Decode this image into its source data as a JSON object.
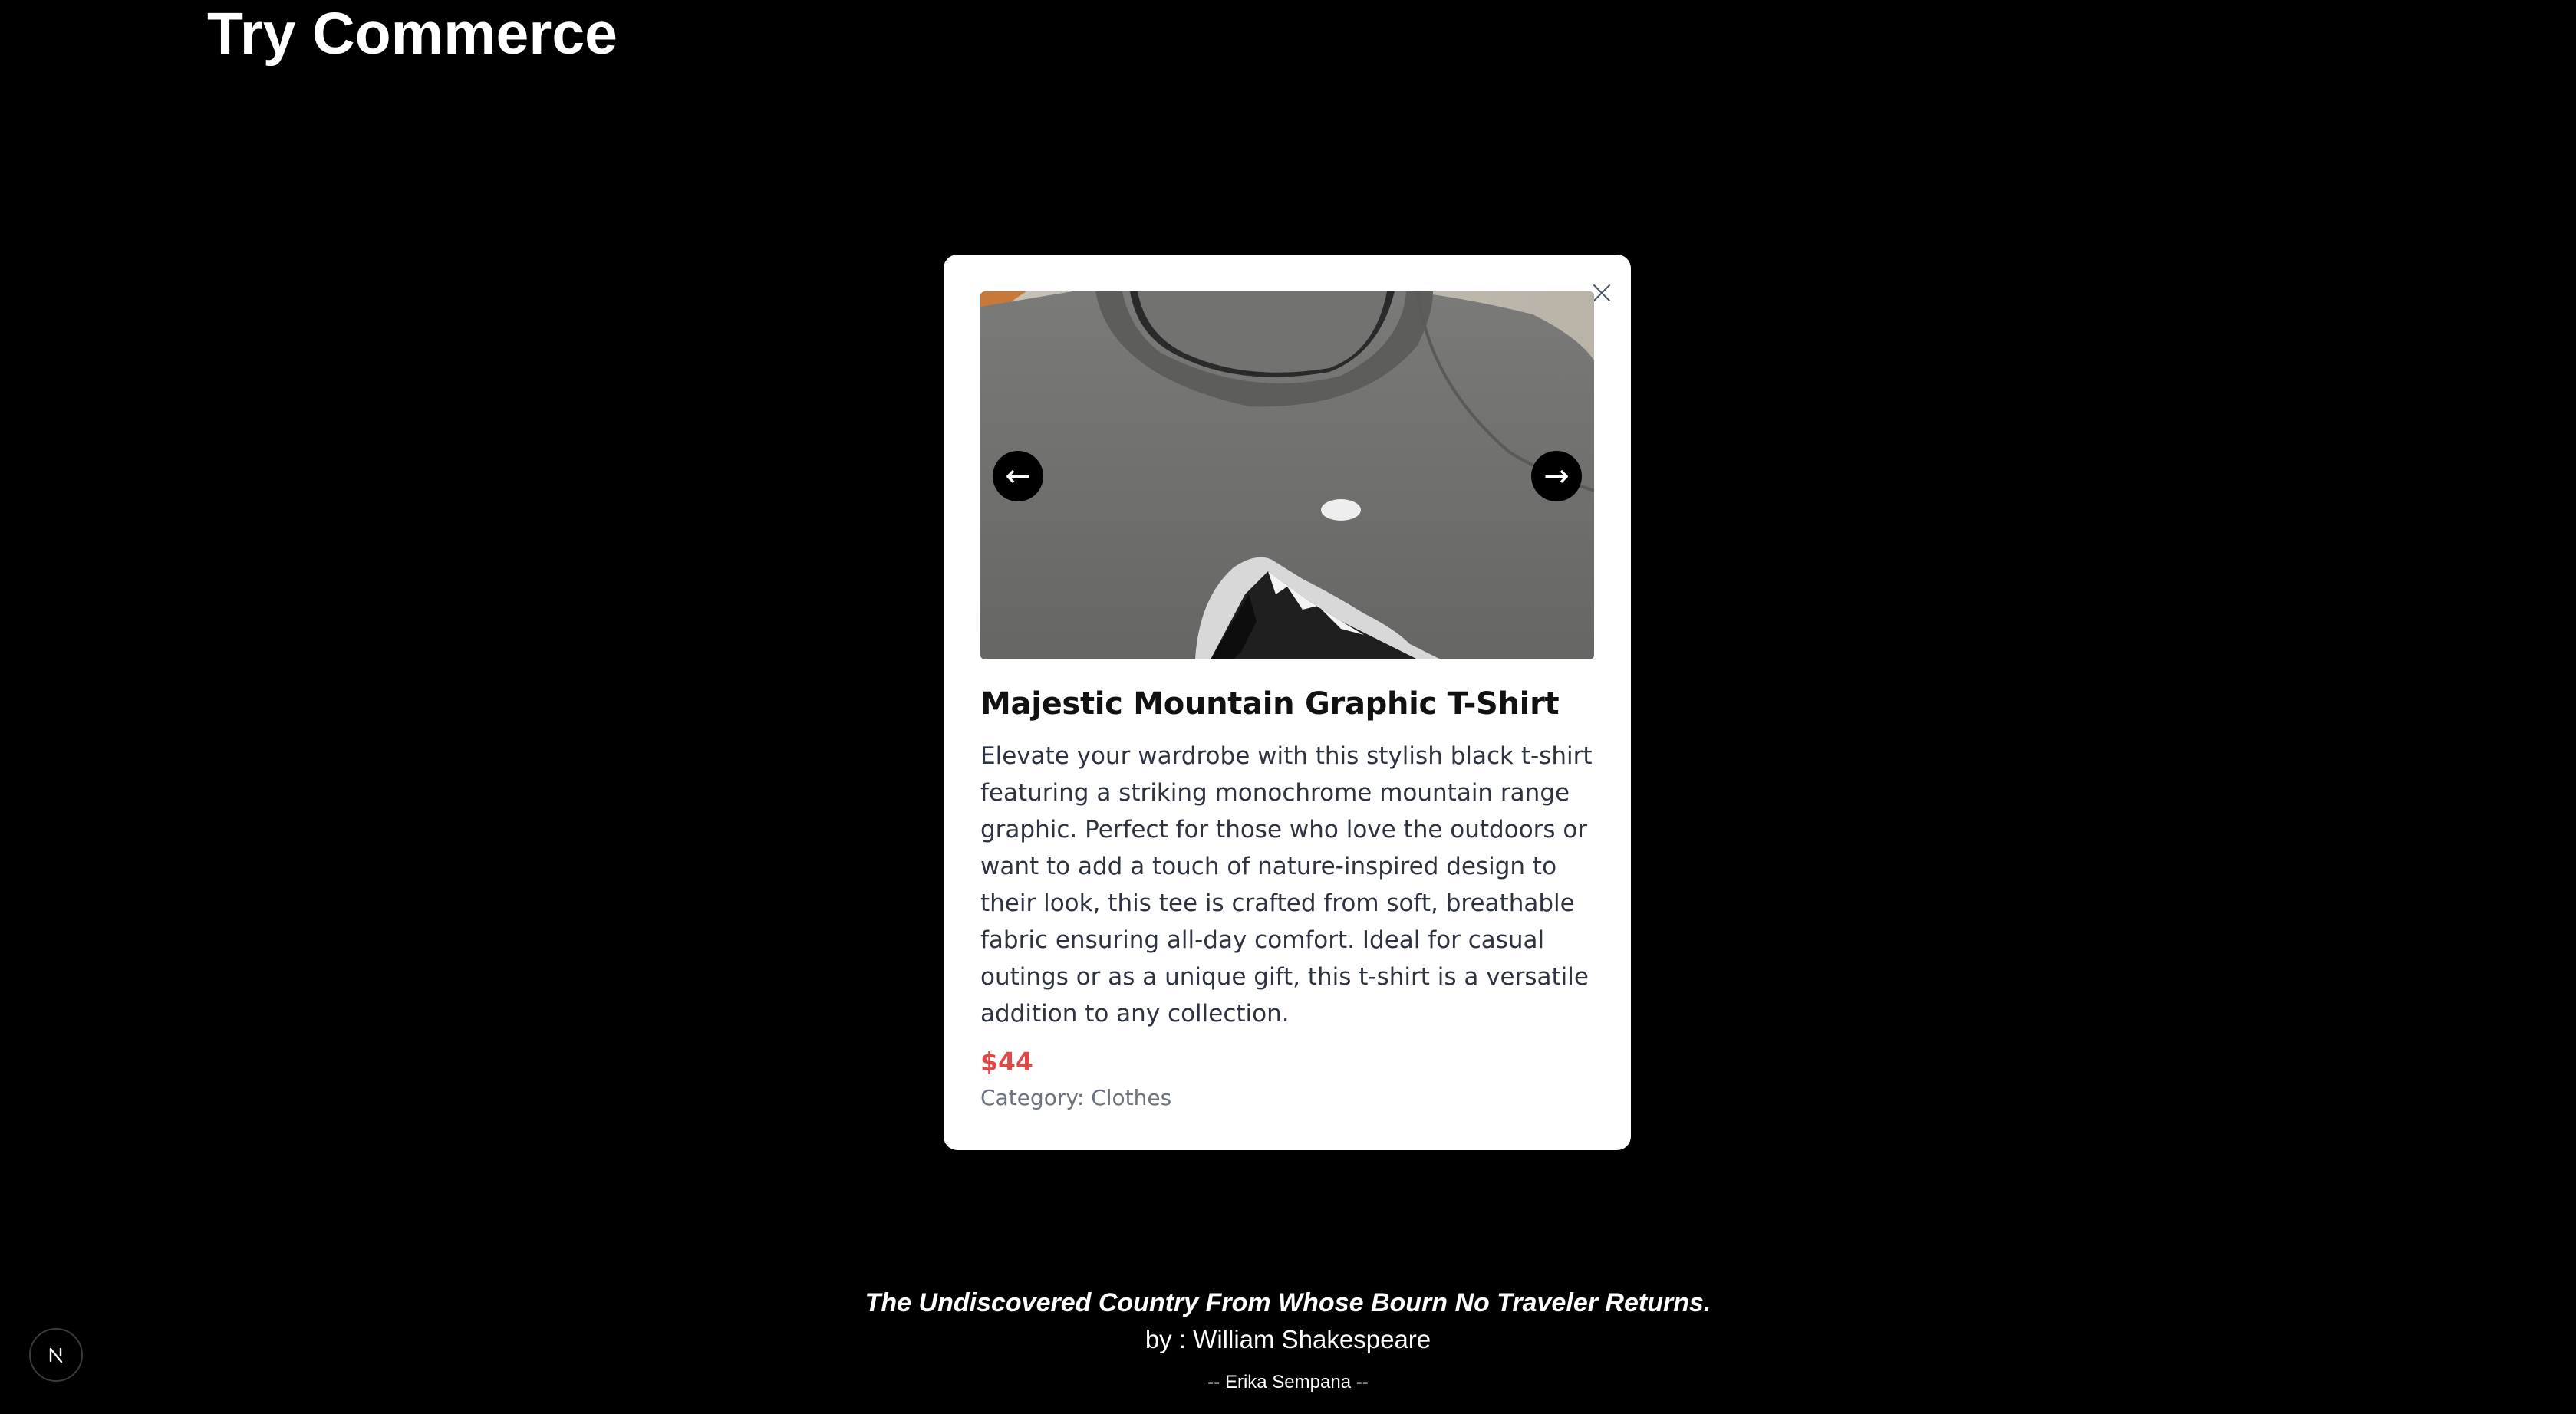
{
  "header": {
    "title": "Try Commerce"
  },
  "modal": {
    "close_icon": "close-icon",
    "carousel": {
      "prev_label": "←",
      "next_label": "→"
    },
    "product": {
      "name": "Majestic Mountain Graphic T-Shirt",
      "description": "Elevate your wardrobe with this stylish black t-shirt featuring a striking monochrome mountain range graphic. Perfect for those who love the outdoors or want to add a touch of nature-inspired design to their look, this tee is crafted from soft, breathable fabric ensuring all-day comfort. Ideal for casual outings or as a unique gift, this t-shirt is a versatile addition to any collection.",
      "price": "$44",
      "category": "Category: Clothes"
    }
  },
  "footer": {
    "quote": "The Undiscovered Country From Whose Bourn No Traveler Returns.",
    "author": "by : William Shakespeare",
    "credit": "-- Erika Sempana --"
  },
  "colors": {
    "background": "#000000",
    "modal_bg": "#ffffff",
    "price": "#e04848",
    "muted": "#6b7280"
  },
  "icons": {
    "close": "close-icon",
    "prev": "arrow-left-icon",
    "next": "arrow-right-icon",
    "badge": "nextjs-logo-icon"
  }
}
